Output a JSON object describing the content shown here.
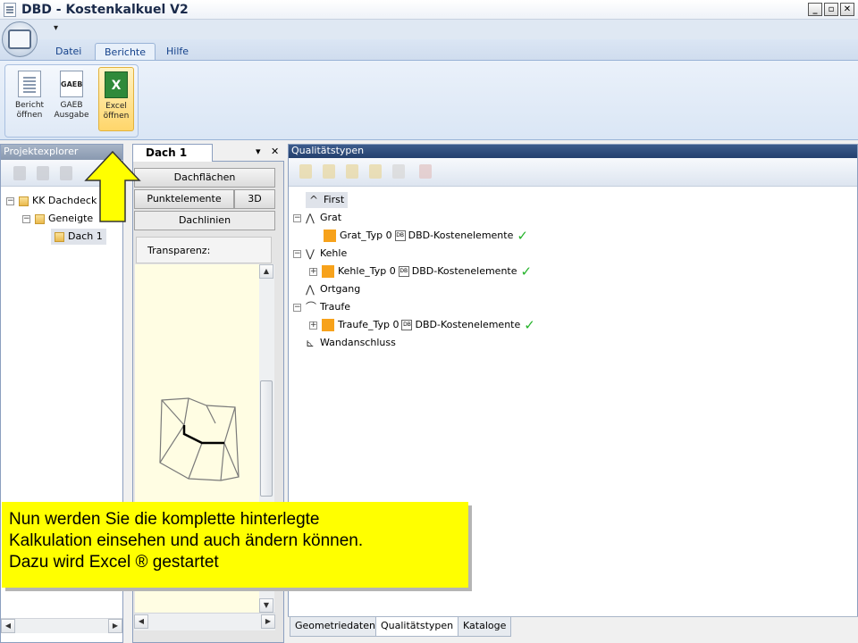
{
  "window": {
    "title": "DBD - Kostenkalkuel V2",
    "min_label": "_",
    "restore_label": "▫",
    "close_label": "✕"
  },
  "ribbon": {
    "tabs": [
      "Datei",
      "Berichte",
      "Hilfe"
    ],
    "active_tab": "Berichte",
    "buttons": [
      {
        "line1": "Bericht",
        "line2": "öffnen",
        "icon": "report-document-icon"
      },
      {
        "line1": "GAEB",
        "line2": "Ausgabe",
        "icon": "gaeb-icon"
      },
      {
        "line1": "Excel",
        "line2": "öffnen",
        "icon": "excel-icon"
      }
    ],
    "gaeb_icon_text": "GAEB",
    "excel_icon_text": "X"
  },
  "projektexplorer": {
    "title": "Projektexplorer",
    "tree": [
      {
        "label": "KK Dachdeck",
        "level": 0,
        "expander": "⊟"
      },
      {
        "label": "Geneigte",
        "level": 1,
        "expander": "⊟"
      },
      {
        "label": "Dach 1",
        "level": 2,
        "selected": true
      }
    ]
  },
  "middle": {
    "doc_tab": "Dach 1",
    "pin": "▾",
    "close": "✕",
    "buttons": {
      "dachflaechen": "Dachflächen",
      "punktelemente": "Punktelemente",
      "threed": "3D",
      "dachlinien": "Dachlinien"
    },
    "transparenz": "Transparenz:"
  },
  "qualitaetstypen": {
    "title": "Qualitätstypen",
    "items": [
      {
        "label": "First",
        "glyph": "^",
        "highlight": true
      },
      {
        "label": "Grat",
        "glyph": "⋀",
        "expander": "⊟"
      },
      {
        "label": "Grat_Typ 0",
        "sub": true,
        "dbd": "DBD-Kostenelemente"
      },
      {
        "label": "Kehle",
        "glyph": "⋁",
        "expander": "⊟"
      },
      {
        "label": "Kehle_Typ 0",
        "sub": true,
        "expander": "⊞",
        "dbd": "DBD-Kostenelemente"
      },
      {
        "label": "Ortgang",
        "glyph": "⋀"
      },
      {
        "label": "Traufe",
        "glyph": "⌒",
        "expander": "⊟"
      },
      {
        "label": "Traufe_Typ 0",
        "sub": true,
        "expander": "⊞",
        "dbd": "DBD-Kostenelemente"
      },
      {
        "label": "Wandanschluss",
        "glyph": "⊾"
      }
    ],
    "check": "✓",
    "dbd_icon_text": "DB"
  },
  "bottom_tabs": [
    "Geometriedaten",
    "Qualitätstypen",
    "Kataloge"
  ],
  "active_bottom_tab": "Qualitätstypen",
  "callout": {
    "line1": "Nun werden Sie die komplette hinterlegte",
    "line2": "Kalkulation einsehen und auch ändern können.",
    "line3": "Dazu wird Excel ® gestartet"
  },
  "colors": {
    "callout_bg": "#ffff00",
    "orange": "#f7a21b",
    "check_green": "#25b32a",
    "header_blue": "#23406e"
  }
}
